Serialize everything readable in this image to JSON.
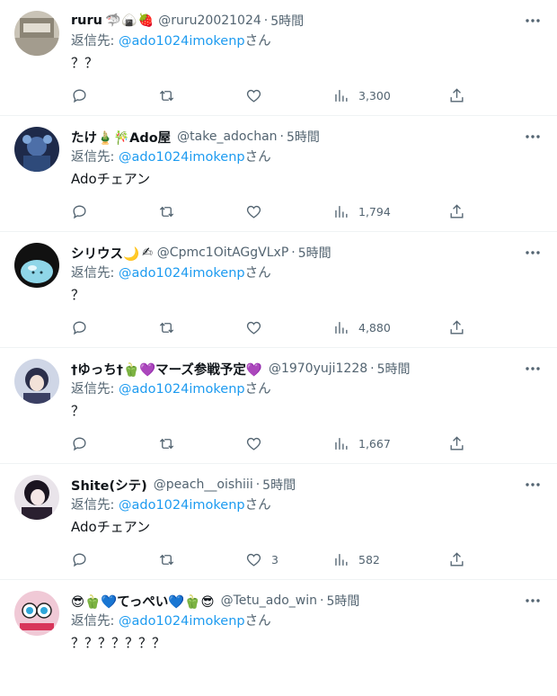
{
  "tweets": [
    {
      "name": "ruru",
      "emojis": "🦈🍙🍓",
      "handle": "@ruru20021024",
      "dot": "·",
      "time": "5時間",
      "reply_prefix": "返信先: ",
      "reply_to": "@ado1024imokenp",
      "reply_suffix": "さん",
      "text": "？？",
      "likes": "",
      "views": "3,300",
      "avatar_icon": "photo-avatar-icon"
    },
    {
      "name": "たけ🎍🎋Ado屋",
      "emojis": "",
      "handle": "@take_adochan",
      "dot": "·",
      "time": "5時間",
      "reply_prefix": "返信先: ",
      "reply_to": "@ado1024imokenp",
      "reply_suffix": "さん",
      "text": "Adoチェアン",
      "likes": "",
      "views": "1,794",
      "avatar_icon": "anime-avatar-icon"
    },
    {
      "name": "シリウス🌙",
      "emojis": "✍",
      "handle": "@Cpmc1OitAGgVLxP",
      "dot": "·",
      "time": "5時間",
      "reply_prefix": "返信先: ",
      "reply_to": "@ado1024imokenp",
      "reply_suffix": "さん",
      "text": "？",
      "likes": "",
      "views": "4,880",
      "avatar_icon": "slime-avatar-icon"
    },
    {
      "name": "†ゆっち†🫑💜マーズ参戦予定💜",
      "emojis": "",
      "handle": "@1970yuji1228",
      "dot": "·",
      "time": "5時間",
      "reply_prefix": "返信先: ",
      "reply_to": "@ado1024imokenp",
      "reply_suffix": "さん",
      "text": "？",
      "likes": "",
      "views": "1,667",
      "avatar_icon": "anime-girl-avatar-icon"
    },
    {
      "name": "Shite(シテ)",
      "emojis": "",
      "handle": "@peach__oishiii",
      "dot": "·",
      "time": "5時間",
      "reply_prefix": "返信先: ",
      "reply_to": "@ado1024imokenp",
      "reply_suffix": "さん",
      "text": "Adoチェアン",
      "likes": "3",
      "views": "582",
      "avatar_icon": "dark-anime-avatar-icon"
    },
    {
      "name": "😎🫑💙てっぺい💙🫑😎",
      "emojis": "",
      "handle": "@Tetu_ado_win",
      "dot": "·",
      "time": "5時間",
      "reply_prefix": "返信先: ",
      "reply_to": "@ado1024imokenp",
      "reply_suffix": "さん",
      "text": "？？？？？？？",
      "likes": "",
      "views": "",
      "avatar_icon": "eye-art-avatar-icon"
    }
  ],
  "colors": {
    "mention": "#1d9bf0",
    "secondary": "#536471",
    "primary": "#0f1419",
    "divider": "#eff3f4"
  }
}
